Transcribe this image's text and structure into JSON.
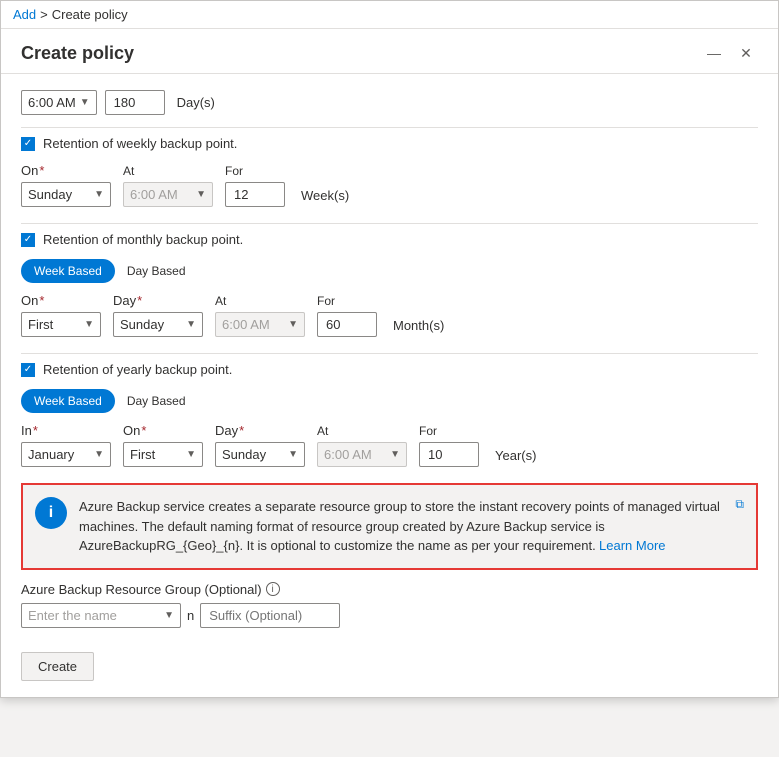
{
  "breadcrumb": {
    "add_label": "Add",
    "sep": ">",
    "current": "Create policy"
  },
  "title": "Create policy",
  "window_buttons": {
    "minimize": "—",
    "close": "✕"
  },
  "top_section": {
    "time_value": "6:00 AM",
    "days_value": "180",
    "days_label": "Day(s)"
  },
  "weekly": {
    "checkbox_checked": true,
    "label": "Retention of weekly backup point.",
    "on_label": "On",
    "at_label": "At",
    "for_label": "For",
    "on_value": "Sunday",
    "at_value": "6:00 AM",
    "for_value": "12",
    "unit_label": "Week(s)"
  },
  "monthly": {
    "checkbox_checked": true,
    "label": "Retention of monthly backup point.",
    "week_based_label": "Week Based",
    "day_based_label": "Day Based",
    "active_toggle": "week",
    "on_label": "On",
    "day_label": "Day",
    "at_label": "At",
    "for_label": "For",
    "on_value": "First",
    "day_value": "Sunday",
    "at_value": "6:00 AM",
    "for_value": "60",
    "unit_label": "Month(s)"
  },
  "yearly": {
    "checkbox_checked": true,
    "label": "Retention of yearly backup point.",
    "week_based_label": "Week Based",
    "day_based_label": "Day Based",
    "active_toggle": "week",
    "in_label": "In",
    "on_label": "On",
    "day_label": "Day",
    "at_label": "At",
    "for_label": "For",
    "in_value": "January",
    "on_value": "First",
    "day_value": "Sunday",
    "at_value": "6:00 AM",
    "for_value": "10",
    "unit_label": "Year(s)"
  },
  "info_box": {
    "icon": "i",
    "text": "Azure Backup service creates a separate resource group to store the instant recovery points of managed virtual machines. The default naming format of resource group created by Azure Backup service is AzureBackupRG_{Geo}_{n}. It is optional to customize the name as per your requirement.",
    "learn_more": "Learn More",
    "external_link_icon": "⧉"
  },
  "resource_group": {
    "label": "Azure Backup Resource Group (Optional)",
    "info_icon": "i",
    "placeholder": "Enter the name",
    "sep": "n",
    "suffix_placeholder": "Suffix (Optional)"
  },
  "footer": {
    "create_label": "Create"
  }
}
